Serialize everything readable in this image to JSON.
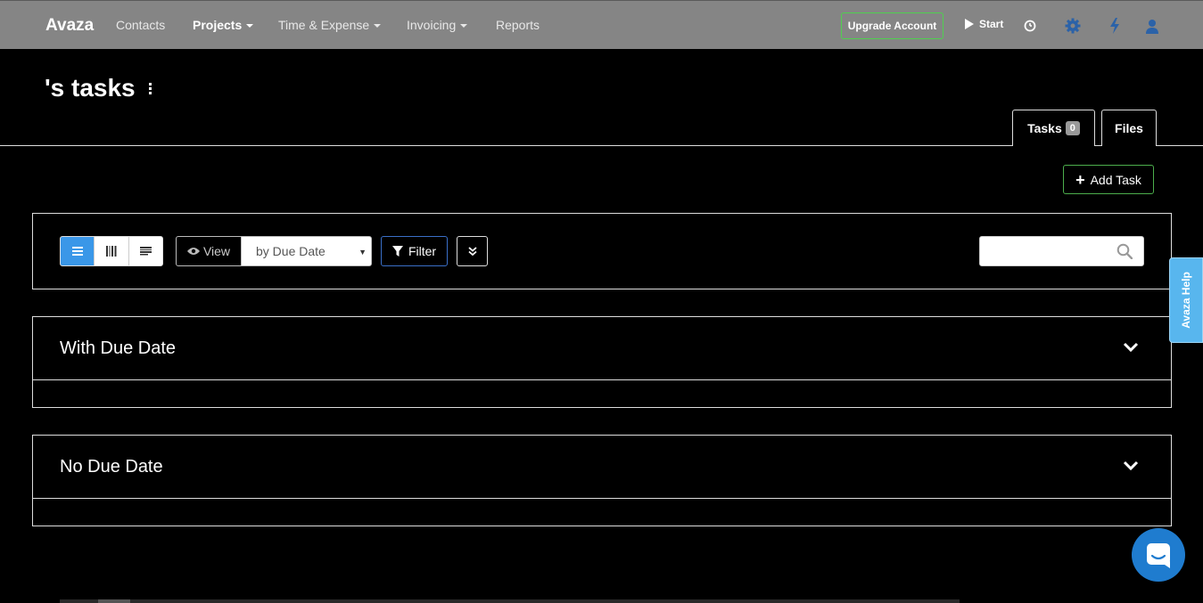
{
  "topbar": {
    "brand": "Avaza",
    "nav": [
      {
        "label": "Contacts"
      },
      {
        "label": "Projects"
      },
      {
        "label": "Time & Expense"
      },
      {
        "label": "Invoicing"
      },
      {
        "label": "Reports"
      }
    ],
    "upgrade_label": "Upgrade Account",
    "start_label": "Start",
    "icons": [
      "play-icon",
      "stopwatch-icon",
      "gear-icon",
      "lightning-icon",
      "user-icon"
    ]
  },
  "page": {
    "title": "'s tasks"
  },
  "tabs": [
    {
      "label": "Tasks",
      "count": "0"
    },
    {
      "label": "Files"
    }
  ],
  "actions": {
    "add_task_label": "Add Task"
  },
  "toolbar": {
    "view_label": "View",
    "view_selected": "by Due Date",
    "filter_label": "Filter",
    "search_placeholder": ""
  },
  "groups": [
    {
      "title": "With Due Date"
    },
    {
      "title": "No Due Date"
    }
  ],
  "help": {
    "label": "Avaza Help"
  },
  "colors": {
    "topbar": "#858585",
    "accent_blue": "#3a97e8",
    "success_green": "#4cae4c",
    "help_tab": "#58b6ee",
    "chat_bubble": "#1f7ccf"
  }
}
